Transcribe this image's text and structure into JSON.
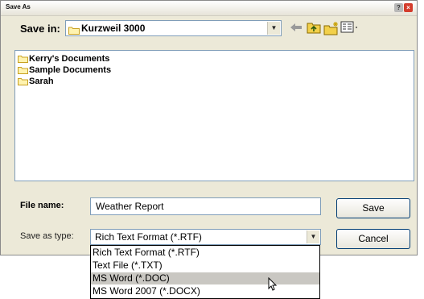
{
  "window": {
    "title": "Save As"
  },
  "save_in": {
    "label": "Save in:",
    "folder": "Kurzweil 3000"
  },
  "toolbar": {
    "icons": [
      "back-arrow-icon",
      "up-folder-icon",
      "new-folder-icon",
      "view-menu-icon"
    ]
  },
  "file_list": {
    "items": [
      {
        "name": "Kerry's Documents",
        "icon": "folder-icon"
      },
      {
        "name": "Sample Documents",
        "icon": "folder-icon"
      },
      {
        "name": "Sarah",
        "icon": "folder-icon"
      }
    ]
  },
  "file_name": {
    "label": "File name:",
    "value": "Weather Report"
  },
  "save_as_type": {
    "label": "Save as type:",
    "selected": "Rich Text Format (*.RTF)",
    "options": [
      "Rich Text Format (*.RTF)",
      "Text File (*.TXT)",
      "MS Word (*.DOC)",
      "MS Word 2007 (*.DOCX)"
    ],
    "highlighted_index": 2
  },
  "buttons": {
    "save": "Save",
    "cancel": "Cancel"
  },
  "colors": {
    "dialog_bg": "#ece9d8",
    "field_border": "#7f9db9",
    "highlight": "#c9c7c2",
    "close": "#d43c2c"
  }
}
